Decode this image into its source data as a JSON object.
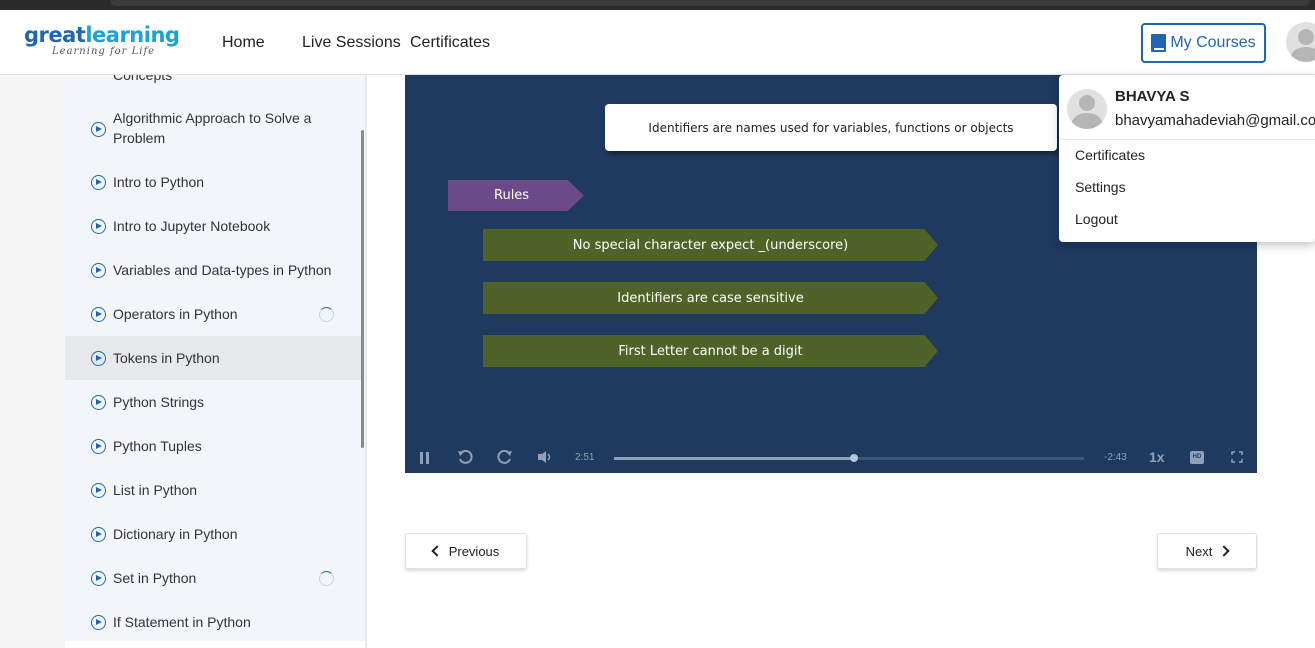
{
  "header": {
    "logo": {
      "brand_main": "great",
      "brand_accent": "learning",
      "tagline": "Learning for Life"
    },
    "nav": [
      "Home",
      "Live Sessions",
      "Certificates"
    ],
    "my_courses_label": "My Courses"
  },
  "sidebar": {
    "partial_item": "Concepts",
    "items": [
      {
        "label": "Algorithmic Approach to Solve a Problem",
        "in_progress": false,
        "active": false
      },
      {
        "label": "Intro to Python",
        "in_progress": false,
        "active": false
      },
      {
        "label": "Intro to Jupyter Notebook",
        "in_progress": false,
        "active": false
      },
      {
        "label": "Variables and Data-types in Python",
        "in_progress": false,
        "active": false
      },
      {
        "label": "Operators in Python",
        "in_progress": true,
        "active": false
      },
      {
        "label": "Tokens in Python",
        "in_progress": false,
        "active": true
      },
      {
        "label": "Python Strings",
        "in_progress": false,
        "active": false
      },
      {
        "label": "Python Tuples",
        "in_progress": false,
        "active": false
      },
      {
        "label": "List in Python",
        "in_progress": false,
        "active": false
      },
      {
        "label": "Dictionary in Python",
        "in_progress": false,
        "active": false
      },
      {
        "label": "Set in Python",
        "in_progress": true,
        "active": false
      },
      {
        "label": "If Statement in Python",
        "in_progress": false,
        "active": false
      }
    ]
  },
  "video": {
    "definition": "Identifiers are names used for variables, functions or objects",
    "rules_heading": "Rules",
    "rules": [
      "No special character expect _(underscore)",
      "Identifiers are case sensitive",
      "First Letter cannot be a digit"
    ],
    "elapsed": "2:51",
    "remaining": "-2:43",
    "speed": "1x",
    "hd_label": "HD",
    "progress": 0.51
  },
  "pager": {
    "previous": "Previous",
    "next": "Next"
  },
  "user_menu": {
    "name": "BHAVYA S",
    "email": "bhavyamahadeviah@gmail.com",
    "items": [
      "Certificates",
      "Settings",
      "Logout"
    ]
  },
  "colors": {
    "brand_blue": "#1f66b3",
    "video_bg": "#1f3a5f",
    "rules_purple": "#6b4a8a",
    "rule_green": "#4f6228"
  },
  "icons": [
    "play-circle-icon",
    "progress-ring-icon",
    "book-icon",
    "avatar-icon",
    "pause-icon",
    "rewind-icon",
    "replay-icon",
    "volume-icon",
    "fullscreen-icon",
    "chevron-left-icon",
    "chevron-right-icon"
  ]
}
